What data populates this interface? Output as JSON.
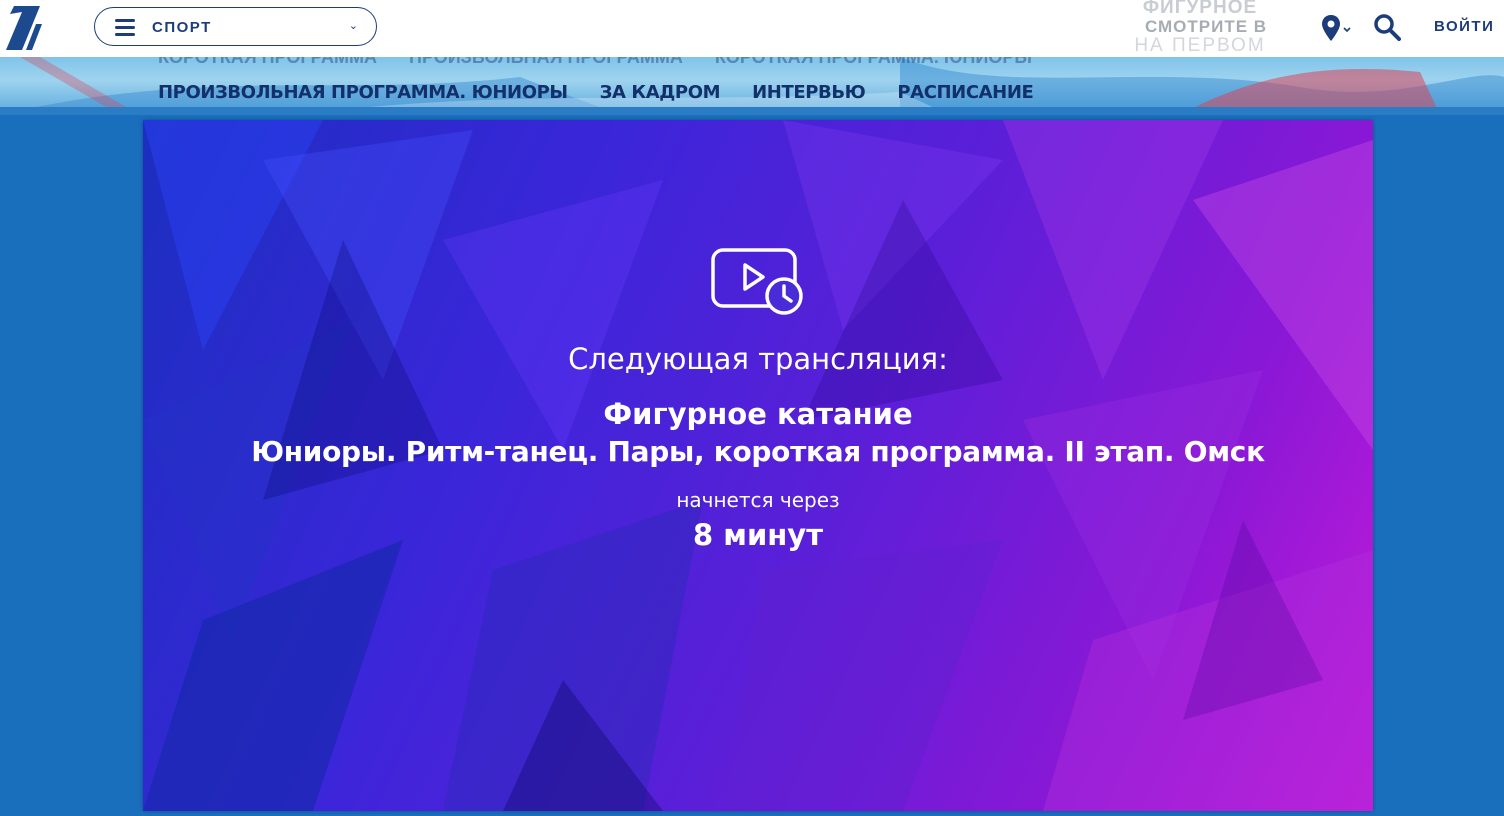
{
  "header": {
    "section_label": "СПОРТ",
    "brand_line1": "ФИГУРНОЕ",
    "brand_line2": "СМОТРИТЕ В",
    "brand_line3": "НА ПЕРВОМ",
    "login_label": "ВОЙТИ"
  },
  "nav": {
    "ghost_items": [
      "КОРОТКАЯ ПРОГРАММА",
      "ПРОИЗВОЛЬНАЯ ПРОГРАММА",
      "КОРОТКАЯ ПРОГРАММА. ЮНИОРЫ"
    ],
    "items": [
      "ПРОИЗВОЛЬНАЯ ПРОГРАММА. ЮНИОРЫ",
      "ЗА КАДРОМ",
      "ИНТЕРВЬЮ",
      "РАСПИСАНИЕ"
    ]
  },
  "player": {
    "next_label": "Следующая трансляция:",
    "event_title": "Фигурное катание",
    "event_subtitle": "Юниоры. Ритм-танец. Пары, короткая программа. II этап. Омск",
    "starts_in_label": "начнется через",
    "countdown": "8 минут"
  },
  "colors": {
    "brand_dark": "#1d3d7a",
    "page_bg": "#1a6fbd",
    "player_gradient_start": "#1b2fbf",
    "player_gradient_end": "#c31bd8"
  },
  "icons": [
    "channel-one-logo",
    "menu-icon",
    "chevron-down-icon",
    "location-pin-icon",
    "search-icon",
    "scheduled-video-icon"
  ]
}
